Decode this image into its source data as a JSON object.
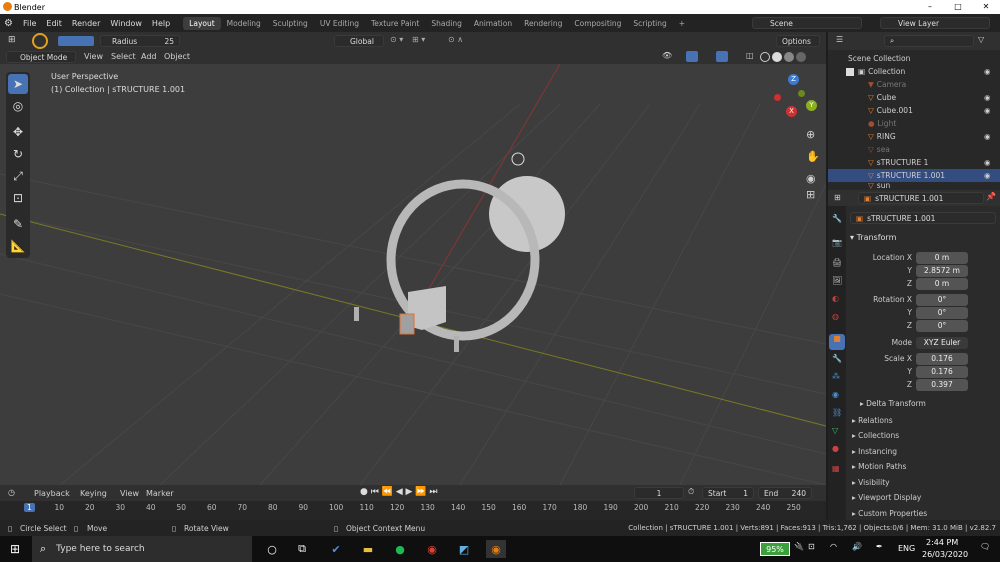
{
  "window": {
    "title": "Blender",
    "controls": [
      "–",
      "□",
      "✕"
    ]
  },
  "menubar": {
    "items": [
      "File",
      "Edit",
      "Render",
      "Window",
      "Help"
    ]
  },
  "workspaces": [
    "Layout",
    "Modeling",
    "Sculpting",
    "UV Editing",
    "Texture Paint",
    "Shading",
    "Animation",
    "Rendering",
    "Compositing",
    "Scripting"
  ],
  "scene": "Scene",
  "view_layer": "View Layer",
  "toolheader": {
    "radius_label": "Radius",
    "radius_value": "25",
    "orientation": "Global",
    "options": "Options"
  },
  "viewport_header": {
    "mode": "Object Mode",
    "menus": [
      "View",
      "Select",
      "Add",
      "Object"
    ]
  },
  "viewport": {
    "perspective": "User Perspective",
    "context": "(1) Collection | sTRUCTURE 1.001"
  },
  "gizmo": {
    "x": "X",
    "y": "Y",
    "z": "Z"
  },
  "outliner": {
    "root": "Scene Collection",
    "collection": "Collection",
    "items": [
      "Camera",
      "Cube",
      "Cube.001",
      "Light",
      "RING",
      "sea",
      "sTRUCTURE 1",
      "sTRUCTURE 1.001",
      "sun"
    ]
  },
  "properties": {
    "header_name": "sTRUCTURE 1.001",
    "object_name": "sTRUCTURE 1.001",
    "transform_title": "Transform",
    "location_label": "Location X",
    "loc": [
      "0 m",
      "2.8572 m",
      "0 m"
    ],
    "rotation_label": "Rotation X",
    "rot": [
      "0°",
      "0°",
      "0°"
    ],
    "mode_label": "Mode",
    "mode_value": "XYZ Euler",
    "scale_label": "Scale X",
    "scale": [
      "0.176",
      "0.176",
      "0.397"
    ],
    "axis_y": "Y",
    "axis_z": "Z",
    "delta": "Delta Transform",
    "sections": [
      "Relations",
      "Collections",
      "Instancing",
      "Motion Paths",
      "Visibility",
      "Viewport Display",
      "Custom Properties"
    ]
  },
  "timeline": {
    "menus": [
      "Playback",
      "Keying",
      "View",
      "Marker"
    ],
    "current": "1",
    "start_label": "Start",
    "start": "1",
    "end_label": "End",
    "end": "240",
    "ticks": [
      "1",
      "10",
      "20",
      "30",
      "40",
      "50",
      "60",
      "70",
      "80",
      "90",
      "100",
      "110",
      "120",
      "130",
      "140",
      "150",
      "160",
      "170",
      "180",
      "190",
      "200",
      "210",
      "220",
      "230",
      "240",
      "250"
    ]
  },
  "status": {
    "left1": "Circle Select",
    "left2": "Move",
    "left3": "Rotate View",
    "left4": "Object Context Menu",
    "right": "Collection | sTRUCTURE 1.001 | Verts:891 | Faces:913 | Tris:1,762 | Objects:0/6 | Mem: 31.0 MiB | v2.82.7"
  },
  "taskbar": {
    "search": "Type here to search",
    "battery": "95%",
    "lang": "ENG",
    "time": "2:44 PM",
    "date": "26/03/2020"
  }
}
